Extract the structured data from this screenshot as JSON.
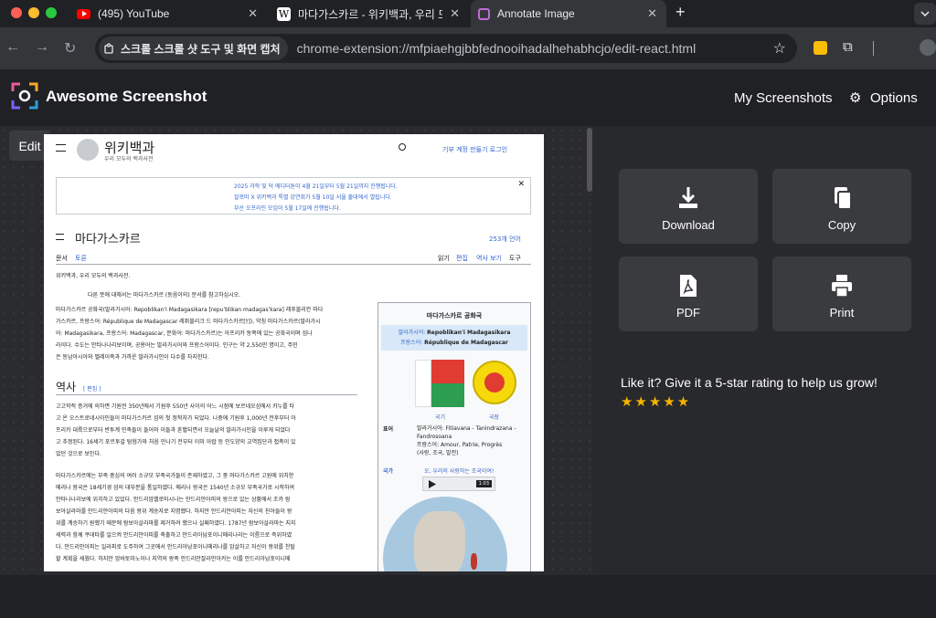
{
  "tabs": [
    {
      "title": "(495) YouTube",
      "icon": "youtube-icon"
    },
    {
      "title": "마다가스카르 - 위키백과, 우리 모두",
      "icon": "wikipedia-icon"
    },
    {
      "title": "Annotate Image",
      "icon": "awesome-screenshot-icon"
    }
  ],
  "new_tab": "+",
  "omnibox": {
    "chip": "스크롤 스크롤 샷 도구 및 화면 캡처",
    "url": "chrome-extension://mfpiaehgjbbfednooihadalhehabhcjo/edit-react.html"
  },
  "app": {
    "name": "Awesome Screenshot",
    "my_screenshots": "My Screenshots",
    "options": "Options",
    "edit_label": "Edit"
  },
  "actions": [
    {
      "label": "Download",
      "icon": "download-icon"
    },
    {
      "label": "Copy",
      "icon": "copy-icon"
    },
    {
      "label": "PDF",
      "icon": "pdf-icon"
    },
    {
      "label": "Print",
      "icon": "print-icon"
    }
  ],
  "rating": {
    "text": "Like it? Give it a 5-star rating to help us grow!",
    "stars": "★★★★★",
    "value": 5
  },
  "wiki": {
    "logo_title": "위키백과",
    "logo_sub": "우리 모두의 백과사전",
    "top_links": "기부  계정 만들기  로그인",
    "notice_1": "2025 과학 및 덕 에디터톤이 4월 21일부터 5월 21일까지 진행됩니다.",
    "notice_2": "잘로마 X 위키백과 특별 강연회가 5월 10일 서울 출대에서 열립니다.",
    "notice_3": "부산 오프라인 모임이 5월 17일에 진행됩니다.",
    "title": "마다가스카르",
    "languages": "253개 언어",
    "tab_article": "문서",
    "tab_talk": "토론",
    "tab_read": "읽기",
    "tab_edit": "편집",
    "tab_history": "역사 보기",
    "tab_tools": "도구",
    "tagline": "위키백과, 우리 모두의 백과사전.",
    "hatnote": "다른 뜻에 대해서는 마다가스카르 (동음이의) 문서를 참고하십시오.",
    "intro_1": "마다가스카르 공화국(말라가시어: Repoblikan'i Madagasikara [repuˈblikan madaɡasˈkarə] 레푸블리칸 마다",
    "intro_2": "가스카르, 프랑스어: République de Madagascar 레퓌블리크 드 마다가스카르[†]), 약칭 마다가스카르(말라가시",
    "intro_3": "어: Madagasikara, 프랑스어: Madagascar, 문화어: 마다가스카르)는 아프리카 동쪽에 있는 공화국이며 섬나",
    "intro_4": "라이다. 수도는 안타나나리보이며, 공용어는 말라가시어와 프랑스어이다. 인구는 약 2,550만 명이고, 주민",
    "intro_5": "은 동남아시아와 멜레이족과 가까운 말라가시인이 다수를 차지한다.",
    "section_history": "역사",
    "section_edit": "[ 편집 ]",
    "hist_p1": [
      "고고학적 증거에 의하면 기원전 350년에서 기원후 550년 사이의 어느 시점에 보르네오섬에서 카누를 타",
      "고 온 오스트로네시아인들이 마다가스카르 섬의 첫 정착자가 되었다. 나중에 기원후 1,000년 전후부터 아",
      "프리카 대륙으로부터 반투계 민족들이 들어와 이들과 혼혈되면서 오늘날의 말라가시인을 이루게 되었다",
      "고 추정된다. 16세기 포르투갈 탐험가와 처음 만나기 전부터 이미 아랍 등 인도양의 교역집단과 접촉이 있",
      "었던 것으로 보인다."
    ],
    "hist_p2": [
      "마다가스카르에는 부족 중심의 여러 소규모 부족국가들이 존재하였고, 그 중 마다가스카르 고원에 위치한",
      "메리나 왕국은 18세기경 섬의 대부분을 통일하였다. 메리나 왕국은 1540년 소규모 부족국가로 시작하여",
      "안타나나리보에 위치하고 있었다. 안드리암벨로마시나는 안드리안아피의 왕으로 있는 상황에서 조카 람",
      "보아살라마를 안드리안아피의 다음 왕위 계승자로 지명했다. 하지만 안드리안아피는 자신의 친아들이 왕",
      "위를 계승하기 원했기 때문에 람보아살라마를 제거하려 했으나 실패하였다. 1787년 람보아살라마는 지지",
      "세력과 함께 쿠데타를 일으켜 안드리안아피를 축출하고 안드리아남포이니메리나라는 이름으로 즉위하였",
      "다. 안드리안아피는 일라피로 도주하여 그곳에서 안드리아남포이니메리나를 암살하고 자신이 왕위를 찬탈",
      "할 계획을 세웠다. 하지만 암바토마노이나 지역의 왕족 안드리안잘라만아카는 이를 안드리아남포이니메"
    ],
    "infobox": {
      "title": "마다가스카르 공화국",
      "malagasy_label": "말라가시어:",
      "malagasy_name": "Repoblikan'i Madagasikara",
      "french_label": "프랑스어:",
      "french_name": "République de Madagascar",
      "flag_caption": "국기",
      "seal_caption": "국장",
      "motto_label": "표어",
      "motto_mg": "말라가시어: Fitiavana - Tanindrazana - Fandrosoana",
      "motto_fr": "프랑스어: Amour, Patrie, Progrès",
      "motto_ko": "(사랑, 조국, 발전)",
      "anthem_label": "국가",
      "anthem_name": "오, 우리의 사랑하는 조국이여!",
      "audio_time": "1:03"
    }
  }
}
